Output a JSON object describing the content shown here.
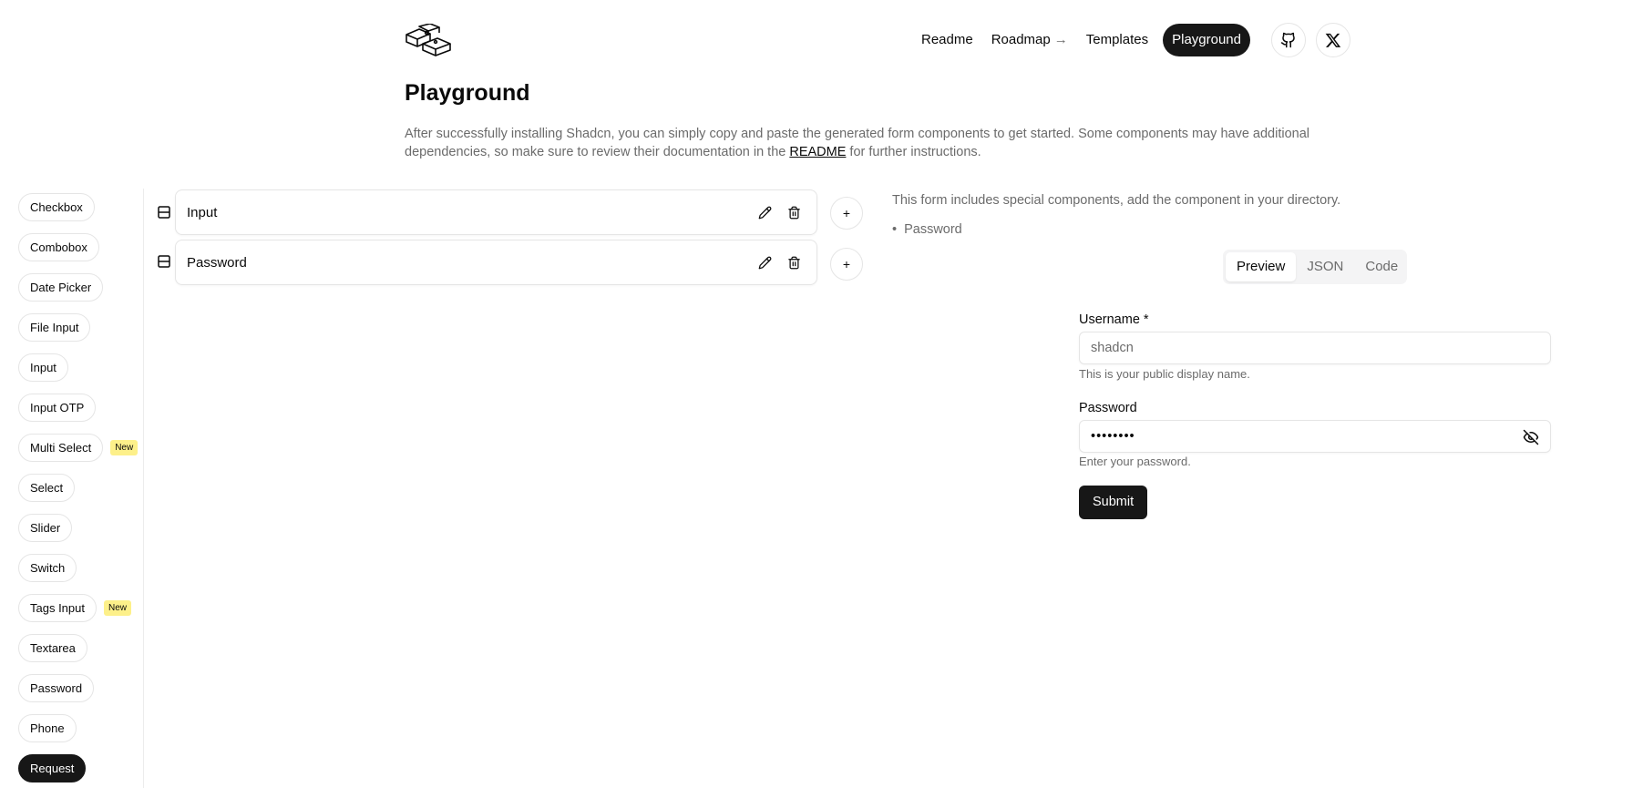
{
  "header": {
    "logo_icon": "boxes-logo-icon",
    "nav": {
      "readme": "Readme",
      "roadmap": "Roadmap",
      "roadmap_arrow": "→",
      "templates": "Templates",
      "playground": "Playground"
    },
    "github_icon": "github-icon",
    "x_icon": "x-icon"
  },
  "page": {
    "title": "Playground",
    "intro_before": "After successfully installing Shadcn, you can simply copy and paste the generated form components to get started. Some components may have additional dependencies, so make sure to review their documentation in the ",
    "intro_link": "README",
    "intro_after": " for further instructions."
  },
  "sidebar": {
    "items": [
      {
        "label": "Checkbox"
      },
      {
        "label": "Combobox"
      },
      {
        "label": "Date Picker"
      },
      {
        "label": "File Input"
      },
      {
        "label": "Input"
      },
      {
        "label": "Input OTP"
      },
      {
        "label": "Multi Select",
        "badge": "New"
      },
      {
        "label": "Select"
      },
      {
        "label": "Slider"
      },
      {
        "label": "Switch"
      },
      {
        "label": "Tags Input",
        "badge": "New"
      },
      {
        "label": "Textarea"
      },
      {
        "label": "Password"
      },
      {
        "label": "Phone"
      },
      {
        "label": "Request",
        "active": true
      }
    ]
  },
  "builder": {
    "fields": [
      {
        "label": "Input",
        "add": "+"
      },
      {
        "label": "Password",
        "add": "+"
      }
    ]
  },
  "preview_panel": {
    "note": "This form includes special components, add the component in your directory.",
    "special_components": [
      "Password"
    ],
    "tabs": [
      "Preview",
      "JSON",
      "Code"
    ],
    "active_tab": "Preview",
    "form": {
      "username_label": "Username",
      "username_required": "*",
      "username_placeholder": "shadcn",
      "username_help": "This is your public display name.",
      "password_label": "Password",
      "password_value": "••••••••",
      "password_help": "Enter your password.",
      "submit_label": "Submit"
    }
  },
  "colors": {
    "dark": "#171717",
    "muted_text": "#6b6b6b",
    "border": "#e5e5e5",
    "badge": "#fdf08a"
  }
}
